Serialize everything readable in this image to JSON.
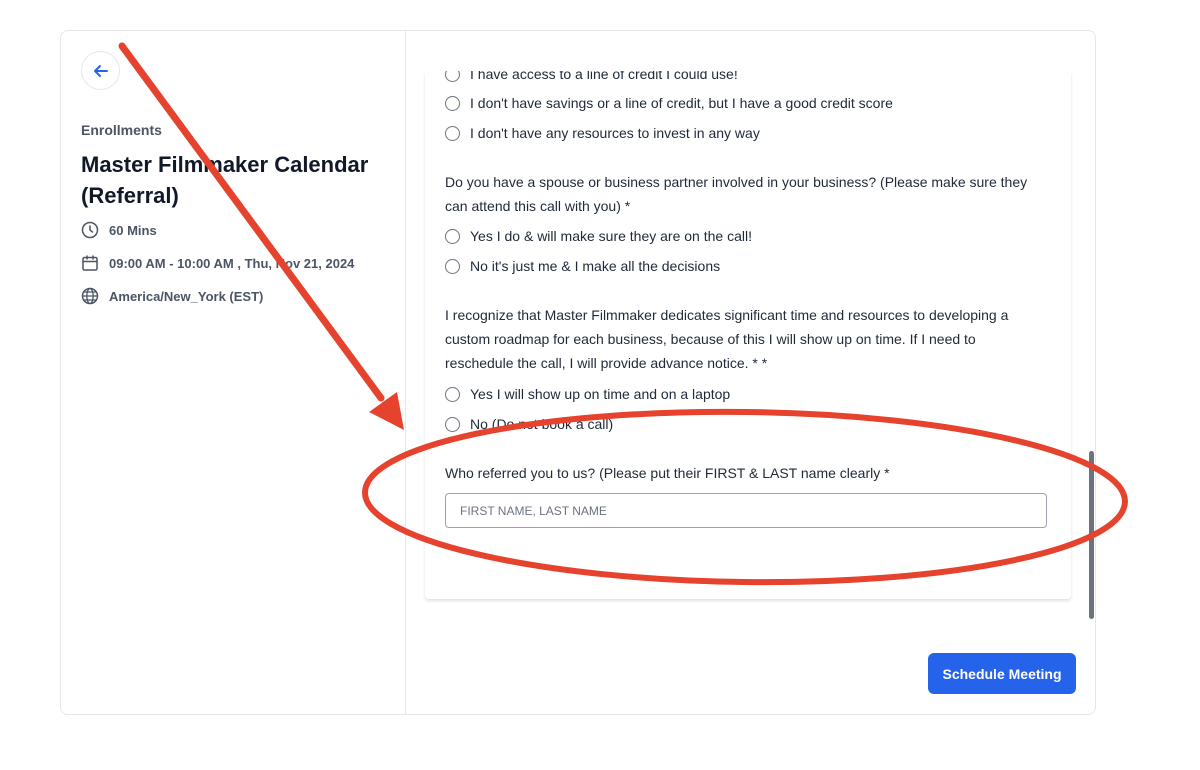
{
  "sidebar": {
    "back_label": "Back",
    "kicker": "Enrollments",
    "title": "Master Filmmaker Calendar (Referral)",
    "duration": "60 Mins",
    "datetime": "09:00 AM - 10:00 AM , Thu, Nov 21, 2024",
    "timezone": "America/New_York (EST)"
  },
  "form": {
    "options_top": [
      "I have access to a line of credit I could use!",
      "I don't have savings or a line of credit, but I have a good credit score",
      "I don't have any resources to invest in any way"
    ],
    "q_partner": "Do you have a spouse or business partner involved in your business? (Please make sure they can attend this call with you) *",
    "partner_options": [
      "Yes I do & will make sure they are on the call!",
      "No it's just me & I make all the decisions"
    ],
    "q_commit": "I recognize that Master Filmmaker dedicates significant time and resources to developing a custom roadmap for each business, because of this I will show up on time. If I need to reschedule the call, I will provide advance notice. * *",
    "commit_options": [
      "Yes I will show up on time and on a laptop",
      "No (Do not book a call)"
    ],
    "q_referral": "Who referred you to us? (Please put their FIRST & LAST name clearly *",
    "referral_placeholder": "FIRST NAME, LAST NAME",
    "referral_value": ""
  },
  "actions": {
    "schedule_label": "Schedule Meeting"
  },
  "colors": {
    "accent": "#2563eb",
    "annotation": "#e5432e"
  }
}
